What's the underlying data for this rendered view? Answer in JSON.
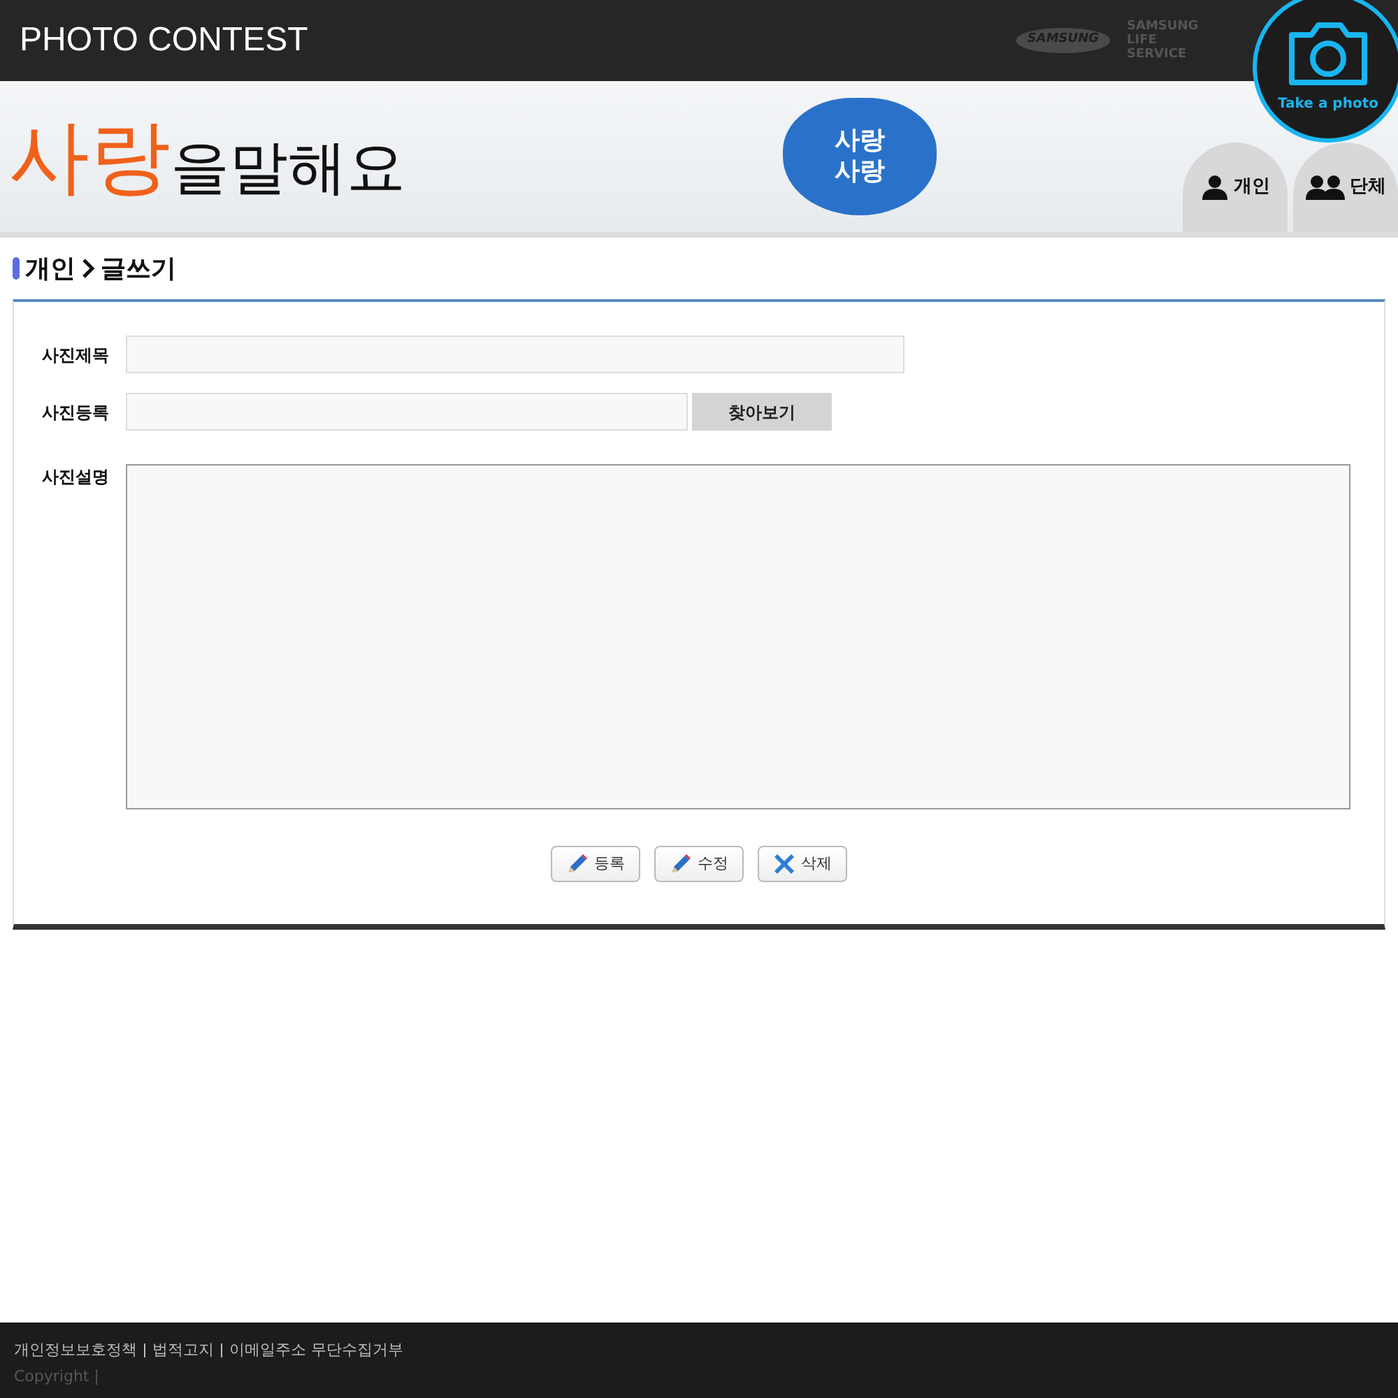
{
  "header": {
    "title": "PHOTO CONTEST",
    "brand_logo": "SAMSUNG",
    "brand_text": "SAMSUNG LIFE SERVICE",
    "take_photo": "Take a photo"
  },
  "banner": {
    "slogan_accent": "사랑",
    "slogan_rest": "을말해요",
    "heart_text": "사랑 사랑",
    "nav": [
      {
        "label": "개인",
        "kind": "person"
      },
      {
        "label": "단체",
        "kind": "group"
      }
    ]
  },
  "breadcrumb": [
    "개인",
    "글쓰기"
  ],
  "form": {
    "fields": [
      {
        "label": "사진제목",
        "kind": "text"
      },
      {
        "label": "사진등록",
        "kind": "file",
        "button": "찾아보기"
      },
      {
        "label": "사진설명",
        "kind": "textarea"
      }
    ],
    "buttons": [
      {
        "label": "등록",
        "kind": "pencil"
      },
      {
        "label": "수정",
        "kind": "edit"
      },
      {
        "label": "삭제",
        "kind": "delete"
      }
    ]
  },
  "footer": {
    "links": [
      "개인정보보호정책",
      "법적고지",
      "이메일주소 무단수집거부"
    ],
    "copyright": "Copyright |"
  }
}
